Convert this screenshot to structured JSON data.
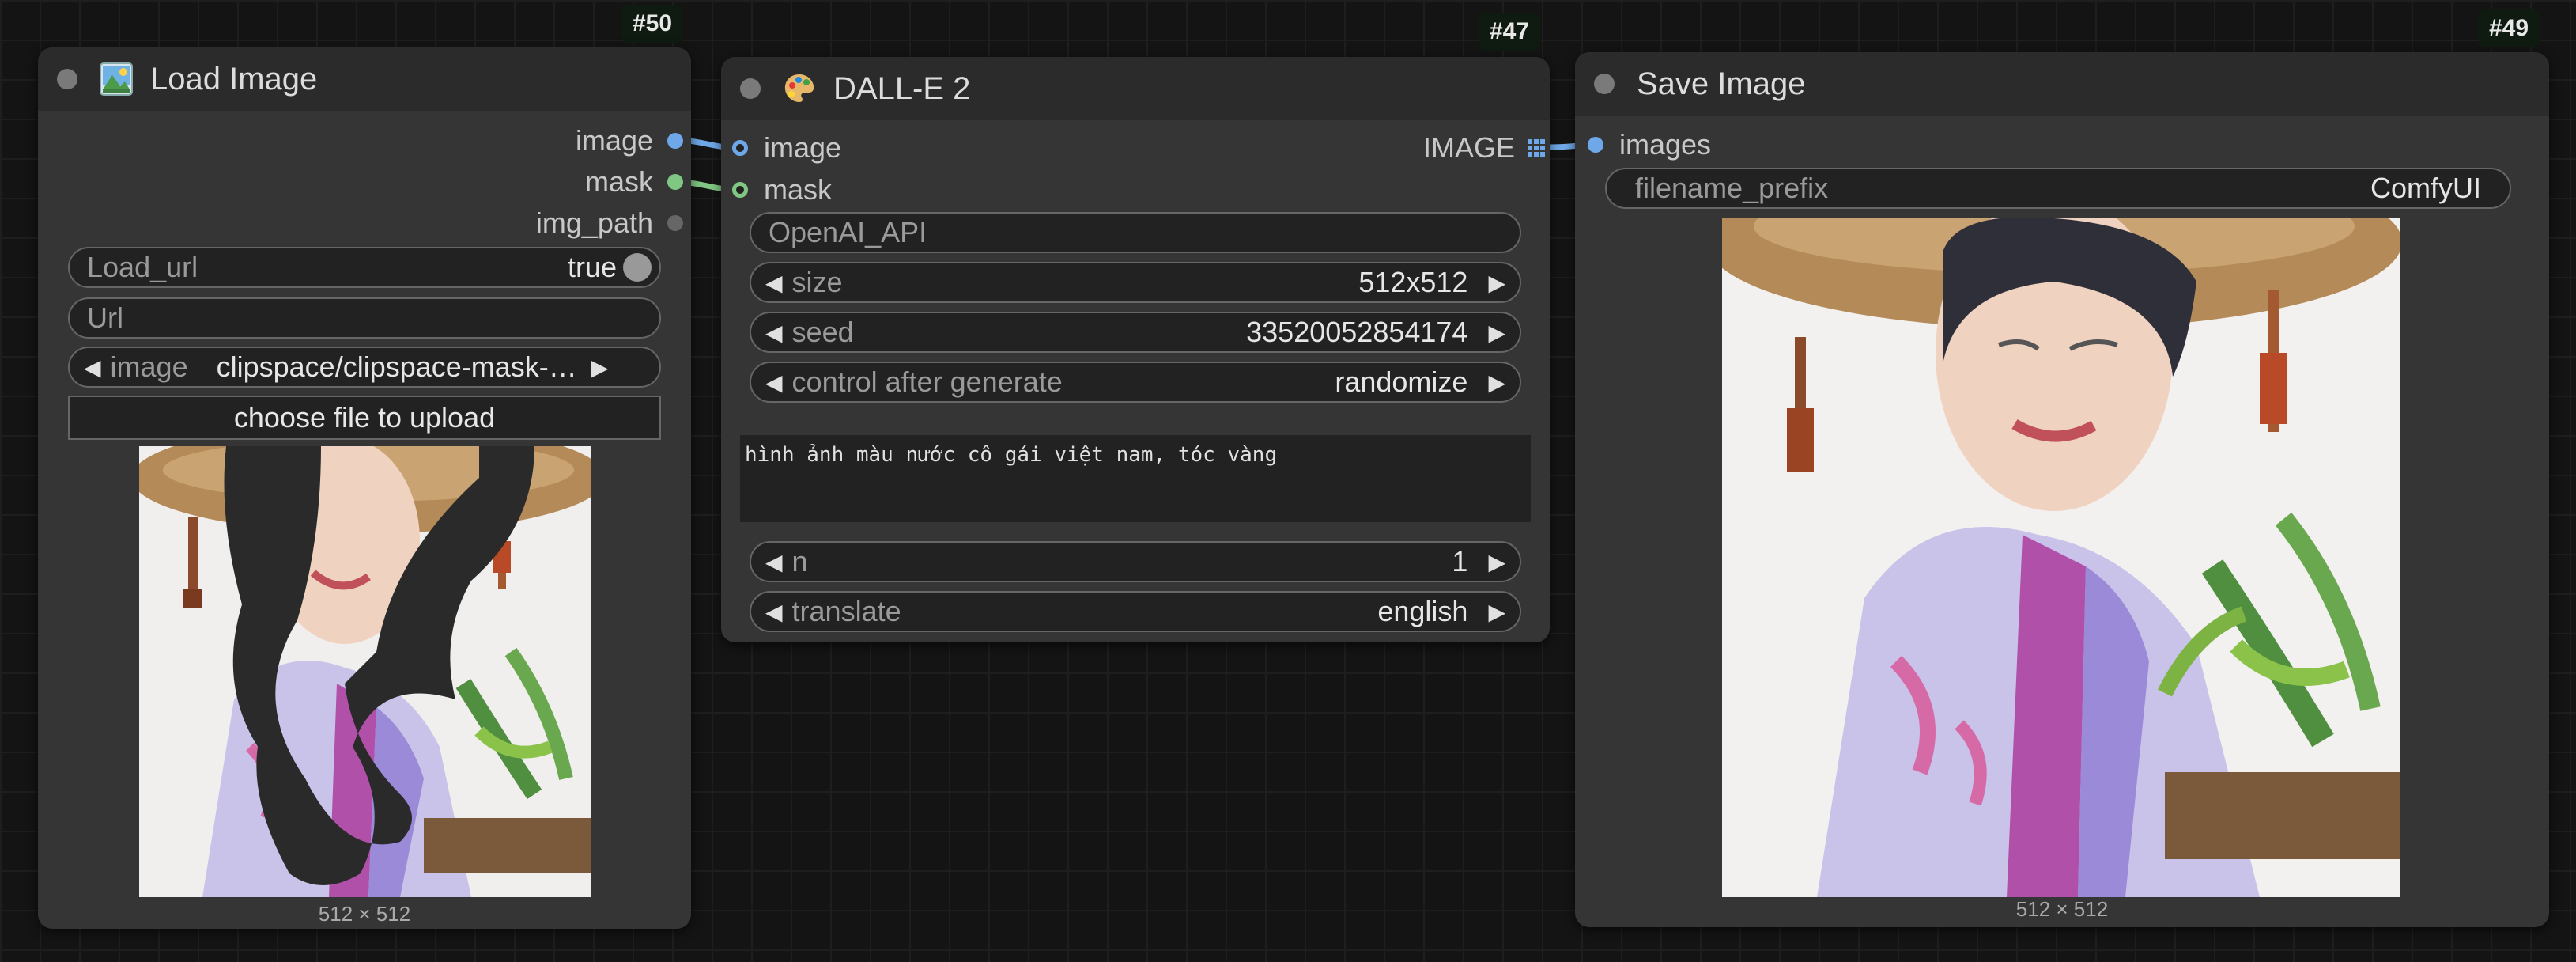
{
  "nodes": {
    "load_image": {
      "id": "#50",
      "title": "Load Image",
      "outputs": [
        "image",
        "mask",
        "img_path"
      ],
      "widgets": {
        "load_url_label": "Load_url",
        "load_url_value": "true",
        "url_placeholder": "Url",
        "image_label": "image",
        "image_value": "clipspace/clipspace-mask-…",
        "upload_button": "choose file to upload"
      },
      "preview_caption": "512 × 512"
    },
    "dalle2": {
      "id": "#47",
      "title": "DALL-E 2",
      "inputs": [
        "image",
        "mask"
      ],
      "output": "IMAGE",
      "widgets": {
        "api": "OpenAI_API",
        "size_label": "size",
        "size_value": "512x512",
        "seed_label": "seed",
        "seed_value": "33520052854174",
        "control_label": "control after generate",
        "control_value": "randomize",
        "prompt": "hình ảnh màu nước cô gái việt nam, tóc vàng",
        "n_label": "n",
        "n_value": "1",
        "translate_label": "translate",
        "translate_value": "english"
      }
    },
    "save_image": {
      "id": "#49",
      "title": "Save Image",
      "input": "images",
      "widgets": {
        "prefix_label": "filename_prefix",
        "prefix_value": "ComfyUI"
      },
      "preview_caption": "512 × 512"
    }
  },
  "colors": {
    "image_link": "#6fa8e8",
    "mask_link": "#81c784",
    "node_bg": "#353535",
    "node_title_bg": "#2b2b2b",
    "canvas_bg": "#141414"
  }
}
